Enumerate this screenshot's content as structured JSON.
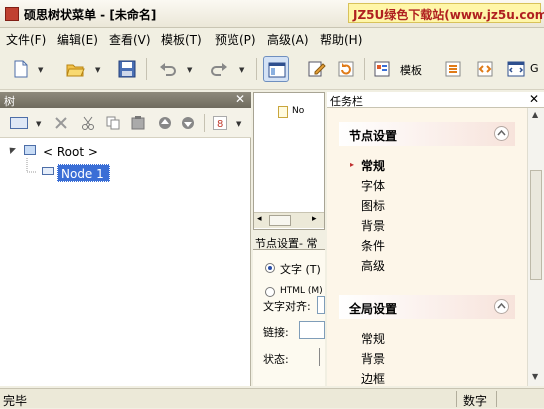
{
  "window": {
    "title": "硕思树状菜单 - [未命名]",
    "watermark": "JZ5U绿色下载站(www.jz5u.com)"
  },
  "menu": [
    "文件(F)",
    "编辑(E)",
    "查看(V)",
    "模板(T)",
    "预览(P)",
    "高级(A)",
    "帮助(H)"
  ],
  "toolbar": {
    "template_label": "模板",
    "trailing_label": "G"
  },
  "tree": {
    "title": "树",
    "root_label": "< Root >",
    "node1_label": "Node 1"
  },
  "middle": {
    "file_label": "No",
    "tab_label": "节点设置- 常",
    "radio_text": "文字 (T)",
    "radio_html": "HTML (M)",
    "text_align": "文字对齐:",
    "link": "链接:",
    "state": "状态:"
  },
  "taskpane": {
    "title": "任务栏",
    "groups": [
      {
        "title": "节点设置",
        "items": [
          "常规",
          "字体",
          "图标",
          "背景",
          "条件",
          "高级"
        ]
      },
      {
        "title": "全局设置",
        "items": [
          "常规",
          "背景",
          "边框"
        ]
      }
    ]
  },
  "status": {
    "ready": "完毕",
    "num": "数字"
  },
  "colors": {
    "accent": "#3a6ed6",
    "watermark_text": "#b02020",
    "group_bg": "#f7e3db"
  }
}
